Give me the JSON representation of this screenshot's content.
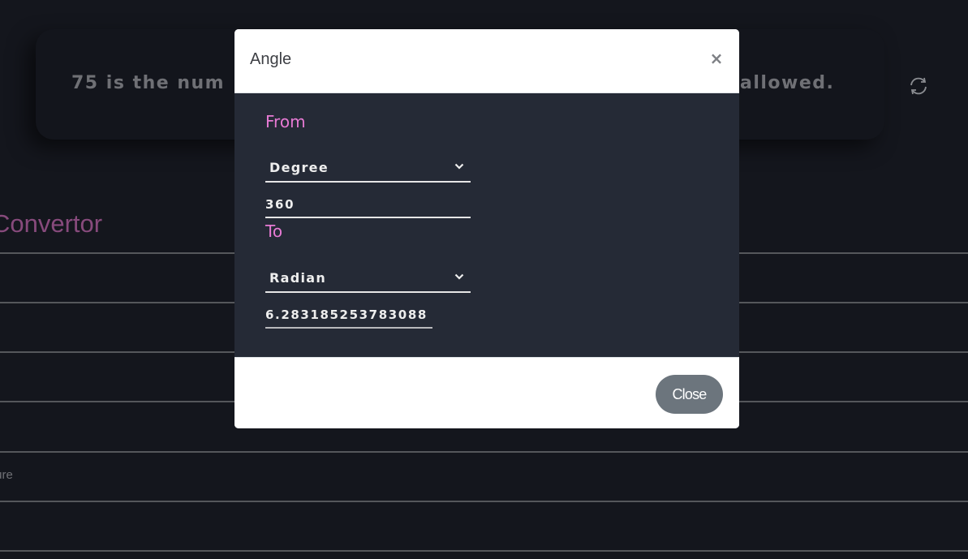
{
  "background": {
    "banner": {
      "text_left": "75 is the num",
      "text_right": "allowed.",
      "refresh_icon": "refresh-icon"
    },
    "section_title": "Convertor",
    "list_rows": [
      "",
      "",
      "",
      "",
      "ture",
      ""
    ]
  },
  "modal": {
    "title": "Angle",
    "close_icon": "close-icon",
    "from": {
      "label": "From",
      "unit": "Degree",
      "value": "360"
    },
    "to": {
      "label": "To",
      "unit": "Radian",
      "value": "6.283185253783088"
    },
    "footer": {
      "close_label": "Close"
    }
  },
  "colors": {
    "accent_pink": "#e77ad4",
    "dimmed_pink": "#874a7c",
    "modal_body": "#252a36",
    "page_background": "#14161d",
    "close_button": "#6c757d"
  }
}
